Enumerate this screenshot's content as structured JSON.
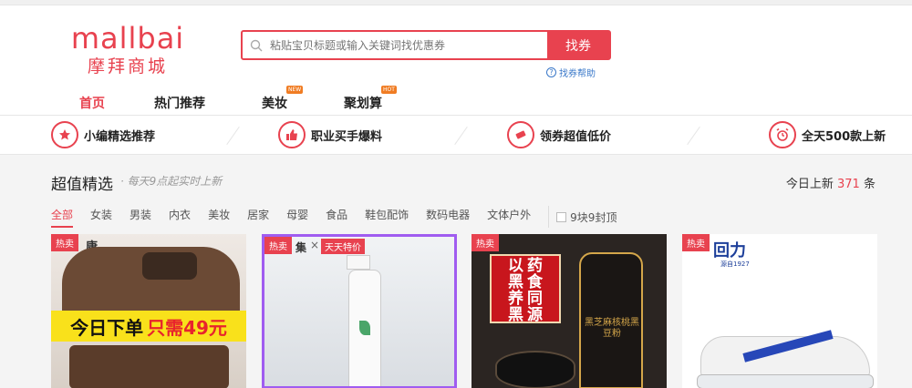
{
  "logo": {
    "en": "mallbai",
    "cn": "摩拜商城"
  },
  "search": {
    "placeholder": "粘贴宝贝标题或输入关键词找优惠券",
    "button": "找券",
    "help": "找券帮助"
  },
  "nav": [
    {
      "label": "首页",
      "badge": ""
    },
    {
      "label": "热门推荐",
      "badge": ""
    },
    {
      "label": "美妆",
      "badge": "NEW"
    },
    {
      "label": "聚划算",
      "badge": "HOT"
    }
  ],
  "features": [
    {
      "label": "小编精选推荐",
      "icon": "star-icon"
    },
    {
      "label": "职业买手爆料",
      "icon": "thumbs-up-icon"
    },
    {
      "label": "领券超值低价",
      "icon": "ticket-icon"
    },
    {
      "label": "全天500款上新",
      "icon": "alarm-clock-icon"
    }
  ],
  "section": {
    "title": "超值精选",
    "subtitle": "· 每天9点起实时上新",
    "count_prefix": "今日上新",
    "count": "371",
    "count_suffix": "条"
  },
  "categories": [
    "全部",
    "女装",
    "男装",
    "内衣",
    "美妆",
    "居家",
    "母婴",
    "食品",
    "鞋包配饰",
    "数码电器",
    "文体户外"
  ],
  "filter": {
    "label": "9块9封顶"
  },
  "cards": [
    {
      "tag": "热卖",
      "brand": "康",
      "promo_text": "今日下单",
      "promo_price": "只需49元"
    },
    {
      "tag": "热卖",
      "brand": "集",
      "cross": "×",
      "sub": "天天特价"
    },
    {
      "tag": "热卖",
      "vertical": [
        "以",
        "黑",
        "养",
        "黑"
      ],
      "vertical2": [
        "药",
        "食",
        "同",
        "源"
      ],
      "jar_text": "黑芝麻核桃黑豆粉"
    },
    {
      "tag": "热卖",
      "brand": "回力",
      "brand_sub": "源自1927"
    }
  ],
  "colors": {
    "accent": "#e8424f",
    "link": "#3a78c9",
    "badge": "#f07c23"
  }
}
